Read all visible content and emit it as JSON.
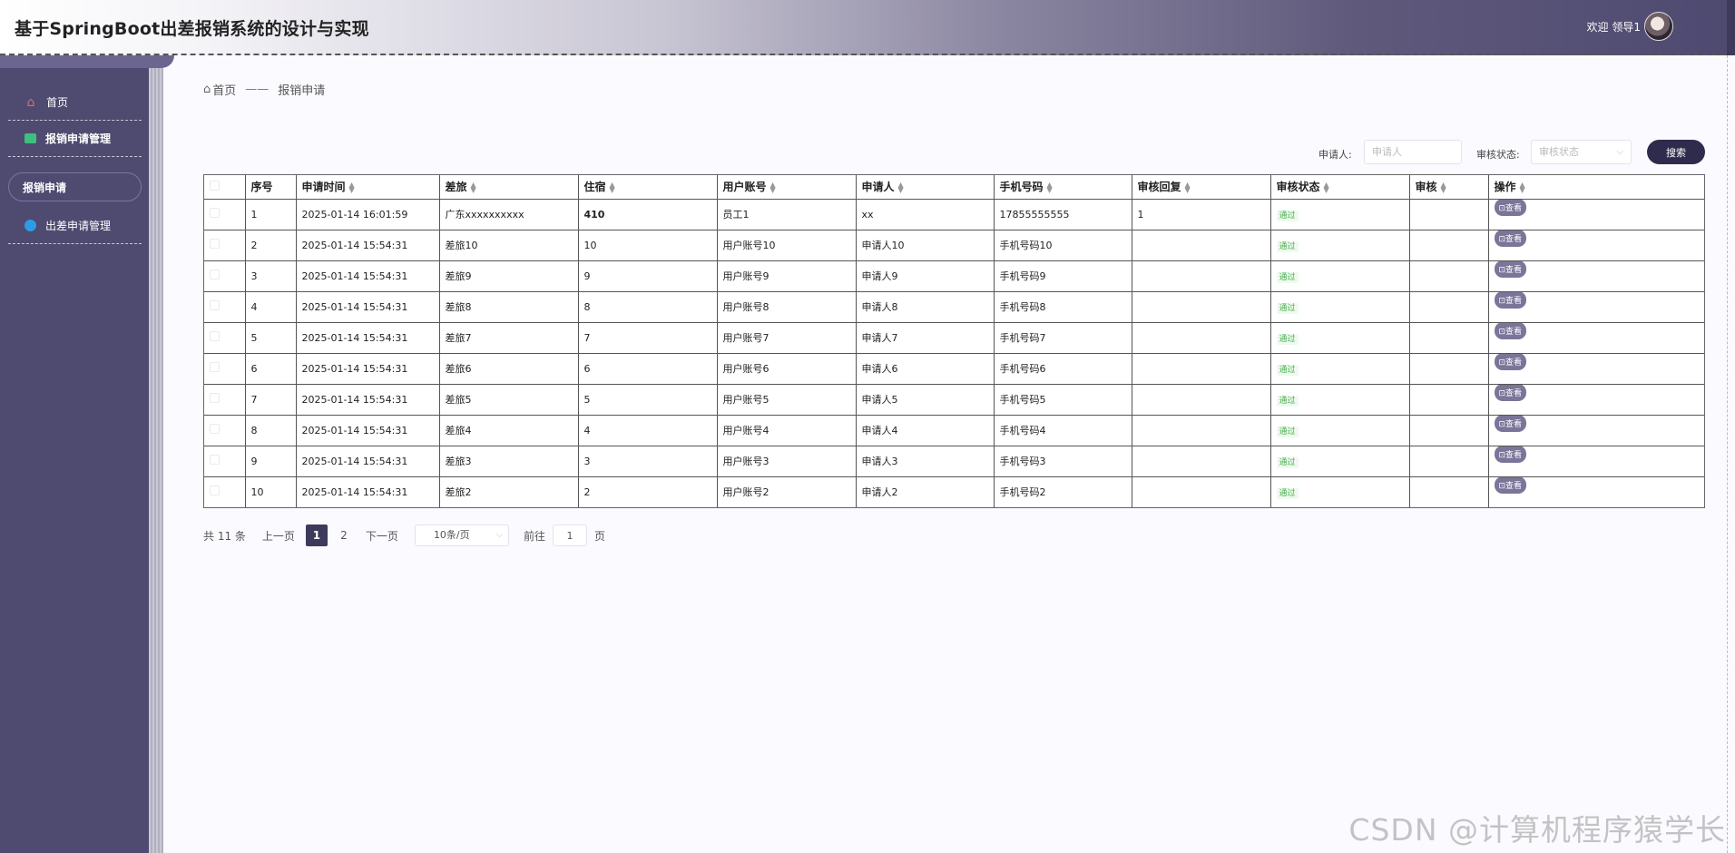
{
  "header": {
    "title": "基于SpringBoot出差报销系统的设计与实现",
    "welcome": "欢迎 领导1"
  },
  "sidebar": {
    "items": [
      {
        "label": "首页",
        "icon": "home-icon"
      },
      {
        "label": "报销申请管理",
        "icon": "square-icon"
      },
      {
        "label": "报销申请",
        "icon": ""
      },
      {
        "label": "出差申请管理",
        "icon": "circle-icon"
      }
    ]
  },
  "breadcrumb": {
    "home": "首页",
    "separator": "——",
    "current": "报销申请"
  },
  "search": {
    "applicant_label": "申请人:",
    "applicant_placeholder": "申请人",
    "status_label": "审核状态:",
    "status_placeholder": "审核状态",
    "button": "搜索"
  },
  "table": {
    "columns": [
      "序号",
      "申请时间",
      "差旅",
      "住宿",
      "用户账号",
      "申请人",
      "手机号码",
      "审核回复",
      "审核状态",
      "审核",
      "操作"
    ],
    "rows": [
      {
        "no": "1",
        "time": "2025-01-14 16:01:59",
        "travel": "广东xxxxxxxxxx",
        "lodging": "410",
        "account": "员工1",
        "applicant": "xx",
        "phone": "17855555555",
        "reply": "1",
        "status": "通过",
        "action": "查看"
      },
      {
        "no": "2",
        "time": "2025-01-14 15:54:31",
        "travel": "差旅10",
        "lodging": "10",
        "account": "用户账号10",
        "applicant": "申请人10",
        "phone": "手机号码10",
        "reply": "",
        "status": "通过",
        "action": "查看"
      },
      {
        "no": "3",
        "time": "2025-01-14 15:54:31",
        "travel": "差旅9",
        "lodging": "9",
        "account": "用户账号9",
        "applicant": "申请人9",
        "phone": "手机号码9",
        "reply": "",
        "status": "通过",
        "action": "查看"
      },
      {
        "no": "4",
        "time": "2025-01-14 15:54:31",
        "travel": "差旅8",
        "lodging": "8",
        "account": "用户账号8",
        "applicant": "申请人8",
        "phone": "手机号码8",
        "reply": "",
        "status": "通过",
        "action": "查看"
      },
      {
        "no": "5",
        "time": "2025-01-14 15:54:31",
        "travel": "差旅7",
        "lodging": "7",
        "account": "用户账号7",
        "applicant": "申请人7",
        "phone": "手机号码7",
        "reply": "",
        "status": "通过",
        "action": "查看"
      },
      {
        "no": "6",
        "time": "2025-01-14 15:54:31",
        "travel": "差旅6",
        "lodging": "6",
        "account": "用户账号6",
        "applicant": "申请人6",
        "phone": "手机号码6",
        "reply": "",
        "status": "通过",
        "action": "查看"
      },
      {
        "no": "7",
        "time": "2025-01-14 15:54:31",
        "travel": "差旅5",
        "lodging": "5",
        "account": "用户账号5",
        "applicant": "申请人5",
        "phone": "手机号码5",
        "reply": "",
        "status": "通过",
        "action": "查看"
      },
      {
        "no": "8",
        "time": "2025-01-14 15:54:31",
        "travel": "差旅4",
        "lodging": "4",
        "account": "用户账号4",
        "applicant": "申请人4",
        "phone": "手机号码4",
        "reply": "",
        "status": "通过",
        "action": "查看"
      },
      {
        "no": "9",
        "time": "2025-01-14 15:54:31",
        "travel": "差旅3",
        "lodging": "3",
        "account": "用户账号3",
        "applicant": "申请人3",
        "phone": "手机号码3",
        "reply": "",
        "status": "通过",
        "action": "查看"
      },
      {
        "no": "10",
        "time": "2025-01-14 15:54:31",
        "travel": "差旅2",
        "lodging": "2",
        "account": "用户账号2",
        "applicant": "申请人2",
        "phone": "手机号码2",
        "reply": "",
        "status": "通过",
        "action": "查看"
      }
    ]
  },
  "pagination": {
    "total": "共 11 条",
    "prev": "上一页",
    "pages": [
      "1",
      "2"
    ],
    "next": "下一页",
    "page_size": "10条/页",
    "goto": "前往",
    "goto_value": "1",
    "page_unit": "页"
  },
  "watermark": "CSDN @计算机程序猿学长",
  "colors": {
    "sidebar": "#4e4a70",
    "accent": "#2e2b4c",
    "status_green": "#4caf50"
  }
}
